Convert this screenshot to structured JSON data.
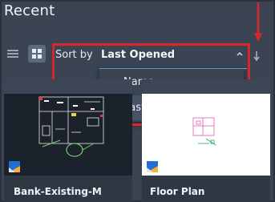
{
  "header": {
    "title": "Recent"
  },
  "toolbar": {
    "sort_label": "Sort by",
    "sort_value": "Last Opened"
  },
  "sort_dropdown": {
    "options": [
      {
        "label": "Name",
        "selected": false
      },
      {
        "label": "Last Opened",
        "selected": true
      }
    ]
  },
  "files": [
    {
      "name": "Bank-Existing-M"
    },
    {
      "name": "Floor Plan"
    }
  ],
  "colors": {
    "background": "#3b4453",
    "accent": "#4fa3f2",
    "annotation_red": "#d9262b"
  }
}
